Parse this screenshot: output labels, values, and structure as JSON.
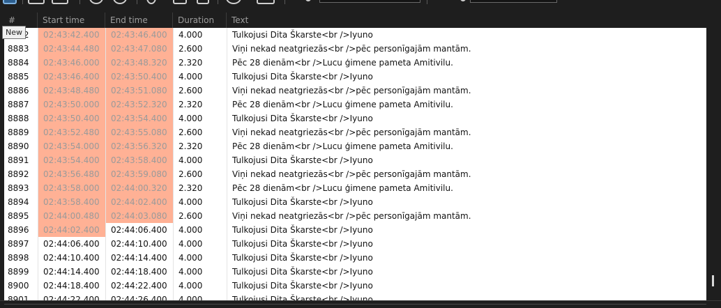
{
  "tooltip": "New",
  "columns": {
    "num": "#",
    "start": "Start time",
    "end": "End time",
    "duration": "Duration",
    "text": "Text"
  },
  "rows": [
    {
      "num": "8882",
      "start": "02:43:42.400",
      "end": "02:43:46.400",
      "duration": "4.000",
      "text": "Tulkojusi Dita Škarste<br />Iyuno",
      "start_hl": true,
      "end_hl": true
    },
    {
      "num": "8883",
      "start": "02:43:44.480",
      "end": "02:43:47.080",
      "duration": "2.600",
      "text": "Viņi nekad neatgriezās<br />pēc personīgajām mantām.",
      "start_hl": true,
      "end_hl": true
    },
    {
      "num": "8884",
      "start": "02:43:46.000",
      "end": "02:43:48.320",
      "duration": "2.320",
      "text": "Pēc 28 dienām<br />Lucu ģimene pameta Amitivilu.",
      "start_hl": true,
      "end_hl": true
    },
    {
      "num": "8885",
      "start": "02:43:46.400",
      "end": "02:43:50.400",
      "duration": "4.000",
      "text": "Tulkojusi Dita Škarste<br />Iyuno",
      "start_hl": true,
      "end_hl": true
    },
    {
      "num": "8886",
      "start": "02:43:48.480",
      "end": "02:43:51.080",
      "duration": "2.600",
      "text": "Viņi nekad neatgriezās<br />pēc personīgajām mantām.",
      "start_hl": true,
      "end_hl": true
    },
    {
      "num": "8887",
      "start": "02:43:50.000",
      "end": "02:43:52.320",
      "duration": "2.320",
      "text": "Pēc 28 dienām<br />Lucu ģimene pameta Amitivilu.",
      "start_hl": true,
      "end_hl": true
    },
    {
      "num": "8888",
      "start": "02:43:50.400",
      "end": "02:43:54.400",
      "duration": "4.000",
      "text": "Tulkojusi Dita Škarste<br />Iyuno",
      "start_hl": true,
      "end_hl": true
    },
    {
      "num": "8889",
      "start": "02:43:52.480",
      "end": "02:43:55.080",
      "duration": "2.600",
      "text": "Viņi nekad neatgriezās<br />pēc personīgajām mantām.",
      "start_hl": true,
      "end_hl": true
    },
    {
      "num": "8890",
      "start": "02:43:54.000",
      "end": "02:43:56.320",
      "duration": "2.320",
      "text": "Pēc 28 dienām<br />Lucu ģimene pameta Amitivilu.",
      "start_hl": true,
      "end_hl": true
    },
    {
      "num": "8891",
      "start": "02:43:54.400",
      "end": "02:43:58.400",
      "duration": "4.000",
      "text": "Tulkojusi Dita Škarste<br />Iyuno",
      "start_hl": true,
      "end_hl": true
    },
    {
      "num": "8892",
      "start": "02:43:56.480",
      "end": "02:43:59.080",
      "duration": "2.600",
      "text": "Viņi nekad neatgriezās<br />pēc personīgajām mantām.",
      "start_hl": true,
      "end_hl": true
    },
    {
      "num": "8893",
      "start": "02:43:58.000",
      "end": "02:44:00.320",
      "duration": "2.320",
      "text": "Pēc 28 dienām<br />Lucu ģimene pameta Amitivilu.",
      "start_hl": true,
      "end_hl": true
    },
    {
      "num": "8894",
      "start": "02:43:58.400",
      "end": "02:44:02.400",
      "duration": "4.000",
      "text": "Tulkojusi Dita Škarste<br />Iyuno",
      "start_hl": true,
      "end_hl": true
    },
    {
      "num": "8895",
      "start": "02:44:00.480",
      "end": "02:44:03.080",
      "duration": "2.600",
      "text": "Viņi nekad neatgriezās<br />pēc personīgajām mantām.",
      "start_hl": true,
      "end_hl": true
    },
    {
      "num": "8896",
      "start": "02:44:02.400",
      "end": "02:44:06.400",
      "duration": "4.000",
      "text": "Tulkojusi Dita Škarste<br />Iyuno",
      "start_hl": true,
      "end_hl": false
    },
    {
      "num": "8897",
      "start": "02:44:06.400",
      "end": "02:44:10.400",
      "duration": "4.000",
      "text": "Tulkojusi Dita Škarste<br />Iyuno",
      "start_hl": false,
      "end_hl": false
    },
    {
      "num": "8898",
      "start": "02:44:10.400",
      "end": "02:44:14.400",
      "duration": "4.000",
      "text": "Tulkojusi Dita Škarste<br />Iyuno",
      "start_hl": false,
      "end_hl": false
    },
    {
      "num": "8899",
      "start": "02:44:14.400",
      "end": "02:44:18.400",
      "duration": "4.000",
      "text": "Tulkojusi Dita Škarste<br />Iyuno",
      "start_hl": false,
      "end_hl": false
    },
    {
      "num": "8900",
      "start": "02:44:18.400",
      "end": "02:44:22.400",
      "duration": "4.000",
      "text": "Tulkojusi Dita Škarste<br />Iyuno",
      "start_hl": false,
      "end_hl": false
    },
    {
      "num": "8901",
      "start": "02:44:22.400",
      "end": "02:44:26.400",
      "duration": "4.000",
      "text": "Tulkojusi Dita Škarste<br />Iyuno",
      "start_hl": false,
      "end_hl": false
    }
  ],
  "colors": {
    "highlight": "#ffb195",
    "background": "#1e1e1e",
    "grid": "#ffffff"
  },
  "icons": [
    "new-file-icon",
    "open-file-icon",
    "save-icon",
    "find-icon",
    "replace-icon",
    "spell-check-icon",
    "settings-icon",
    "help-icon",
    "layout-icon"
  ]
}
